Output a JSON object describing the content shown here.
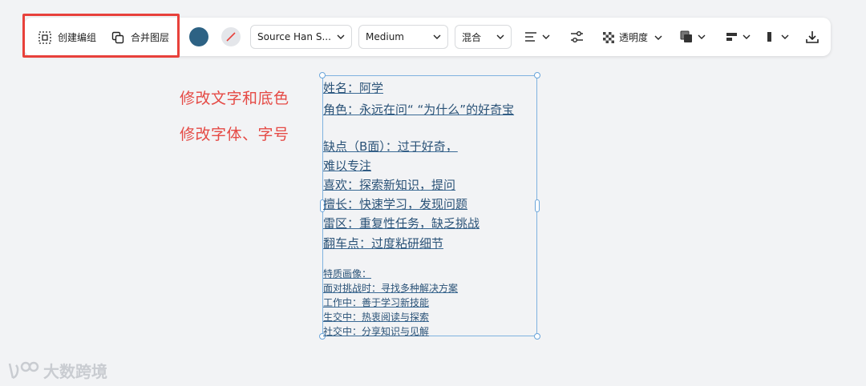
{
  "toolbar": {
    "create_group_label": "创建编组",
    "merge_layers_label": "合并图层",
    "fill_color": "#2d6284",
    "stroke_color": "none",
    "font_family": "Source Han S...",
    "font_weight": "Medium",
    "blend_mode": "混合",
    "opacity_label": "透明度",
    "icons": [
      "group-icon",
      "merge-layers-icon",
      "align-text-icon",
      "adjust-sliders-icon",
      "opacity-checker-icon",
      "layer-order-icon",
      "align-objects-icon",
      "distribute-icon",
      "download-icon"
    ]
  },
  "annotations": {
    "line1": "修改文字和底色",
    "line2": "修改字体、字号"
  },
  "textbox": {
    "lines_big": [
      "姓名：阿学",
      "角色：永远在问“ “为什么”的好奇宝",
      "缺点（B面）：过于好奇，",
      "难以专注",
      "喜欢：探索新知识，提问",
      "擅长：快速学习，发现问题",
      "雷区：重复性任务，缺乏挑战",
      "翻车点：过度粘研细节"
    ],
    "lines_small": [
      "特质画像：",
      "面对挑战时：寻找多种解决方案",
      "工作中：善于学习新技能",
      "生交中：热衷阅读与探索",
      "社交中：分享知识与见解"
    ]
  },
  "watermark": {
    "text": "大数跨境"
  }
}
